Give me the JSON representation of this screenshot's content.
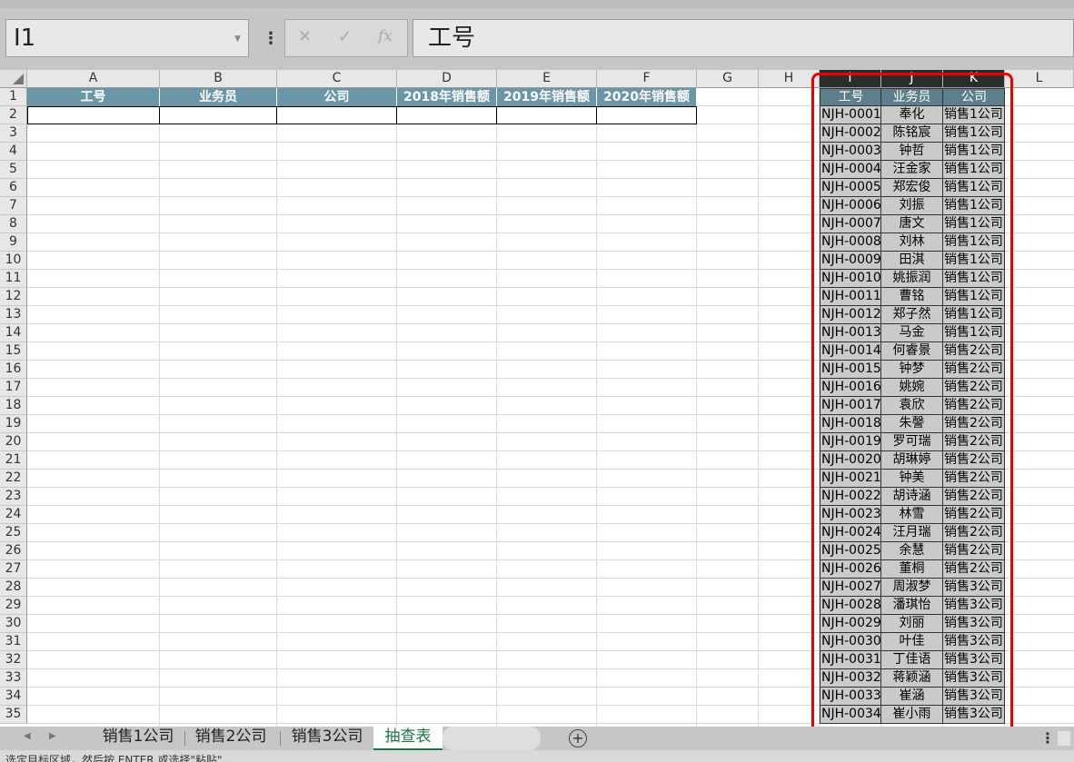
{
  "name_box": {
    "value": "I1"
  },
  "formula_bar": {
    "value": "工号",
    "cancel": "✕",
    "enter": "✓",
    "fx": "fx"
  },
  "columns": [
    "A",
    "B",
    "C",
    "D",
    "E",
    "F",
    "G",
    "H",
    "I",
    "J",
    "K",
    "L"
  ],
  "rows": [
    "1",
    "2",
    "3",
    "4",
    "5",
    "6",
    "7",
    "8",
    "9",
    "10",
    "11",
    "12",
    "13",
    "14",
    "15",
    "16",
    "17",
    "18",
    "19",
    "20",
    "21",
    "22",
    "23",
    "24",
    "25",
    "26",
    "27",
    "28",
    "29",
    "30",
    "31",
    "32",
    "33",
    "34",
    "35"
  ],
  "lookup_headers": [
    "工号",
    "业务员",
    "公司",
    "2018年销售额",
    "2019年销售额",
    "2020年销售额"
  ],
  "source_table": {
    "headers": [
      "工号",
      "业务员",
      "公司"
    ],
    "rows": [
      [
        "NJH-0001",
        "奉化",
        "销售1公司"
      ],
      [
        "NJH-0002",
        "陈铭宸",
        "销售1公司"
      ],
      [
        "NJH-0003",
        "钟哲",
        "销售1公司"
      ],
      [
        "NJH-0004",
        "汪金家",
        "销售1公司"
      ],
      [
        "NJH-0005",
        "郑宏俊",
        "销售1公司"
      ],
      [
        "NJH-0006",
        "刘振",
        "销售1公司"
      ],
      [
        "NJH-0007",
        "唐文",
        "销售1公司"
      ],
      [
        "NJH-0008",
        "刘林",
        "销售1公司"
      ],
      [
        "NJH-0009",
        "田淇",
        "销售1公司"
      ],
      [
        "NJH-0010",
        "姚振润",
        "销售1公司"
      ],
      [
        "NJH-0011",
        "曹铭",
        "销售1公司"
      ],
      [
        "NJH-0012",
        "郑子然",
        "销售1公司"
      ],
      [
        "NJH-0013",
        "马金",
        "销售1公司"
      ],
      [
        "NJH-0014",
        "何睿景",
        "销售2公司"
      ],
      [
        "NJH-0015",
        "钟梦",
        "销售2公司"
      ],
      [
        "NJH-0016",
        "姚婉",
        "销售2公司"
      ],
      [
        "NJH-0017",
        "袁欣",
        "销售2公司"
      ],
      [
        "NJH-0018",
        "朱謦",
        "销售2公司"
      ],
      [
        "NJH-0019",
        "罗可瑞",
        "销售2公司"
      ],
      [
        "NJH-0020",
        "胡琳婷",
        "销售2公司"
      ],
      [
        "NJH-0021",
        "钟美",
        "销售2公司"
      ],
      [
        "NJH-0022",
        "胡诗涵",
        "销售2公司"
      ],
      [
        "NJH-0023",
        "林雪",
        "销售2公司"
      ],
      [
        "NJH-0024",
        "汪月瑞",
        "销售2公司"
      ],
      [
        "NJH-0025",
        "余慧",
        "销售2公司"
      ],
      [
        "NJH-0026",
        "董桐",
        "销售2公司"
      ],
      [
        "NJH-0027",
        "周淑梦",
        "销售3公司"
      ],
      [
        "NJH-0028",
        "潘琪怡",
        "销售3公司"
      ],
      [
        "NJH-0029",
        "刘丽",
        "销售3公司"
      ],
      [
        "NJH-0030",
        "叶佳",
        "销售3公司"
      ],
      [
        "NJH-0031",
        "丁佳语",
        "销售3公司"
      ],
      [
        "NJH-0032",
        "蒋颖涵",
        "销售3公司"
      ],
      [
        "NJH-0033",
        "崔涵",
        "销售3公司"
      ],
      [
        "NJH-0034",
        "崔小雨",
        "销售3公司"
      ]
    ]
  },
  "sheet_tabs": [
    "销售1公司",
    "销售2公司",
    "销售3公司",
    "抽查表"
  ],
  "active_sheet": "抽查表",
  "status_text": "选定目标区域，然后按 ENTER 或选择\"粘贴\"",
  "colors": {
    "header_fill": "#6a96a8",
    "selection_box": "#ee0000",
    "active_tab": "#217346"
  }
}
